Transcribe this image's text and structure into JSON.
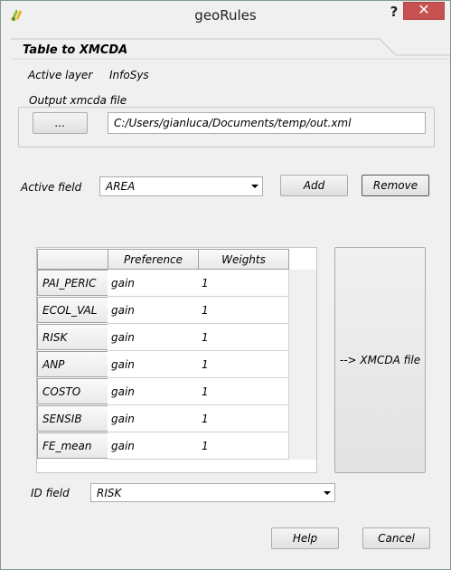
{
  "window": {
    "title": "geoRules",
    "help_glyph": "?",
    "close_glyph": "✕"
  },
  "tab": {
    "title": "Table to XMCDA"
  },
  "active_layer": {
    "label": "Active layer",
    "value": "InfoSys"
  },
  "output": {
    "group_title": "Output xmcda file",
    "browse_label": "...",
    "path": "C:/Users/gianluca/Documents/temp/out.xml"
  },
  "active_field": {
    "label": "Active field",
    "value": "AREA",
    "add_label": "Add",
    "remove_label": "Remove"
  },
  "table": {
    "headers": [
      "Preference",
      "Weights"
    ],
    "rows": [
      {
        "name": "PAI_PERIC",
        "preference": "gain",
        "weight": "1"
      },
      {
        "name": "ECOL_VAL",
        "preference": "gain",
        "weight": "1"
      },
      {
        "name": "RISK",
        "preference": "gain",
        "weight": "1"
      },
      {
        "name": "ANP",
        "preference": "gain",
        "weight": "1"
      },
      {
        "name": "COSTO",
        "preference": "gain",
        "weight": "1"
      },
      {
        "name": "SENSIB",
        "preference": "gain",
        "weight": "1"
      },
      {
        "name": "FE_mean",
        "preference": "gain",
        "weight": "1"
      }
    ]
  },
  "export_button": {
    "label": "--> XMCDA file"
  },
  "id_field": {
    "label": "ID  field",
    "value": "RISK"
  },
  "footer": {
    "help_label": "Help",
    "cancel_label": "Cancel"
  },
  "colors": {
    "close": "#c75050",
    "window_bg": "#f0f0f0"
  },
  "icons": {
    "app": "qgis-logo-icon"
  }
}
